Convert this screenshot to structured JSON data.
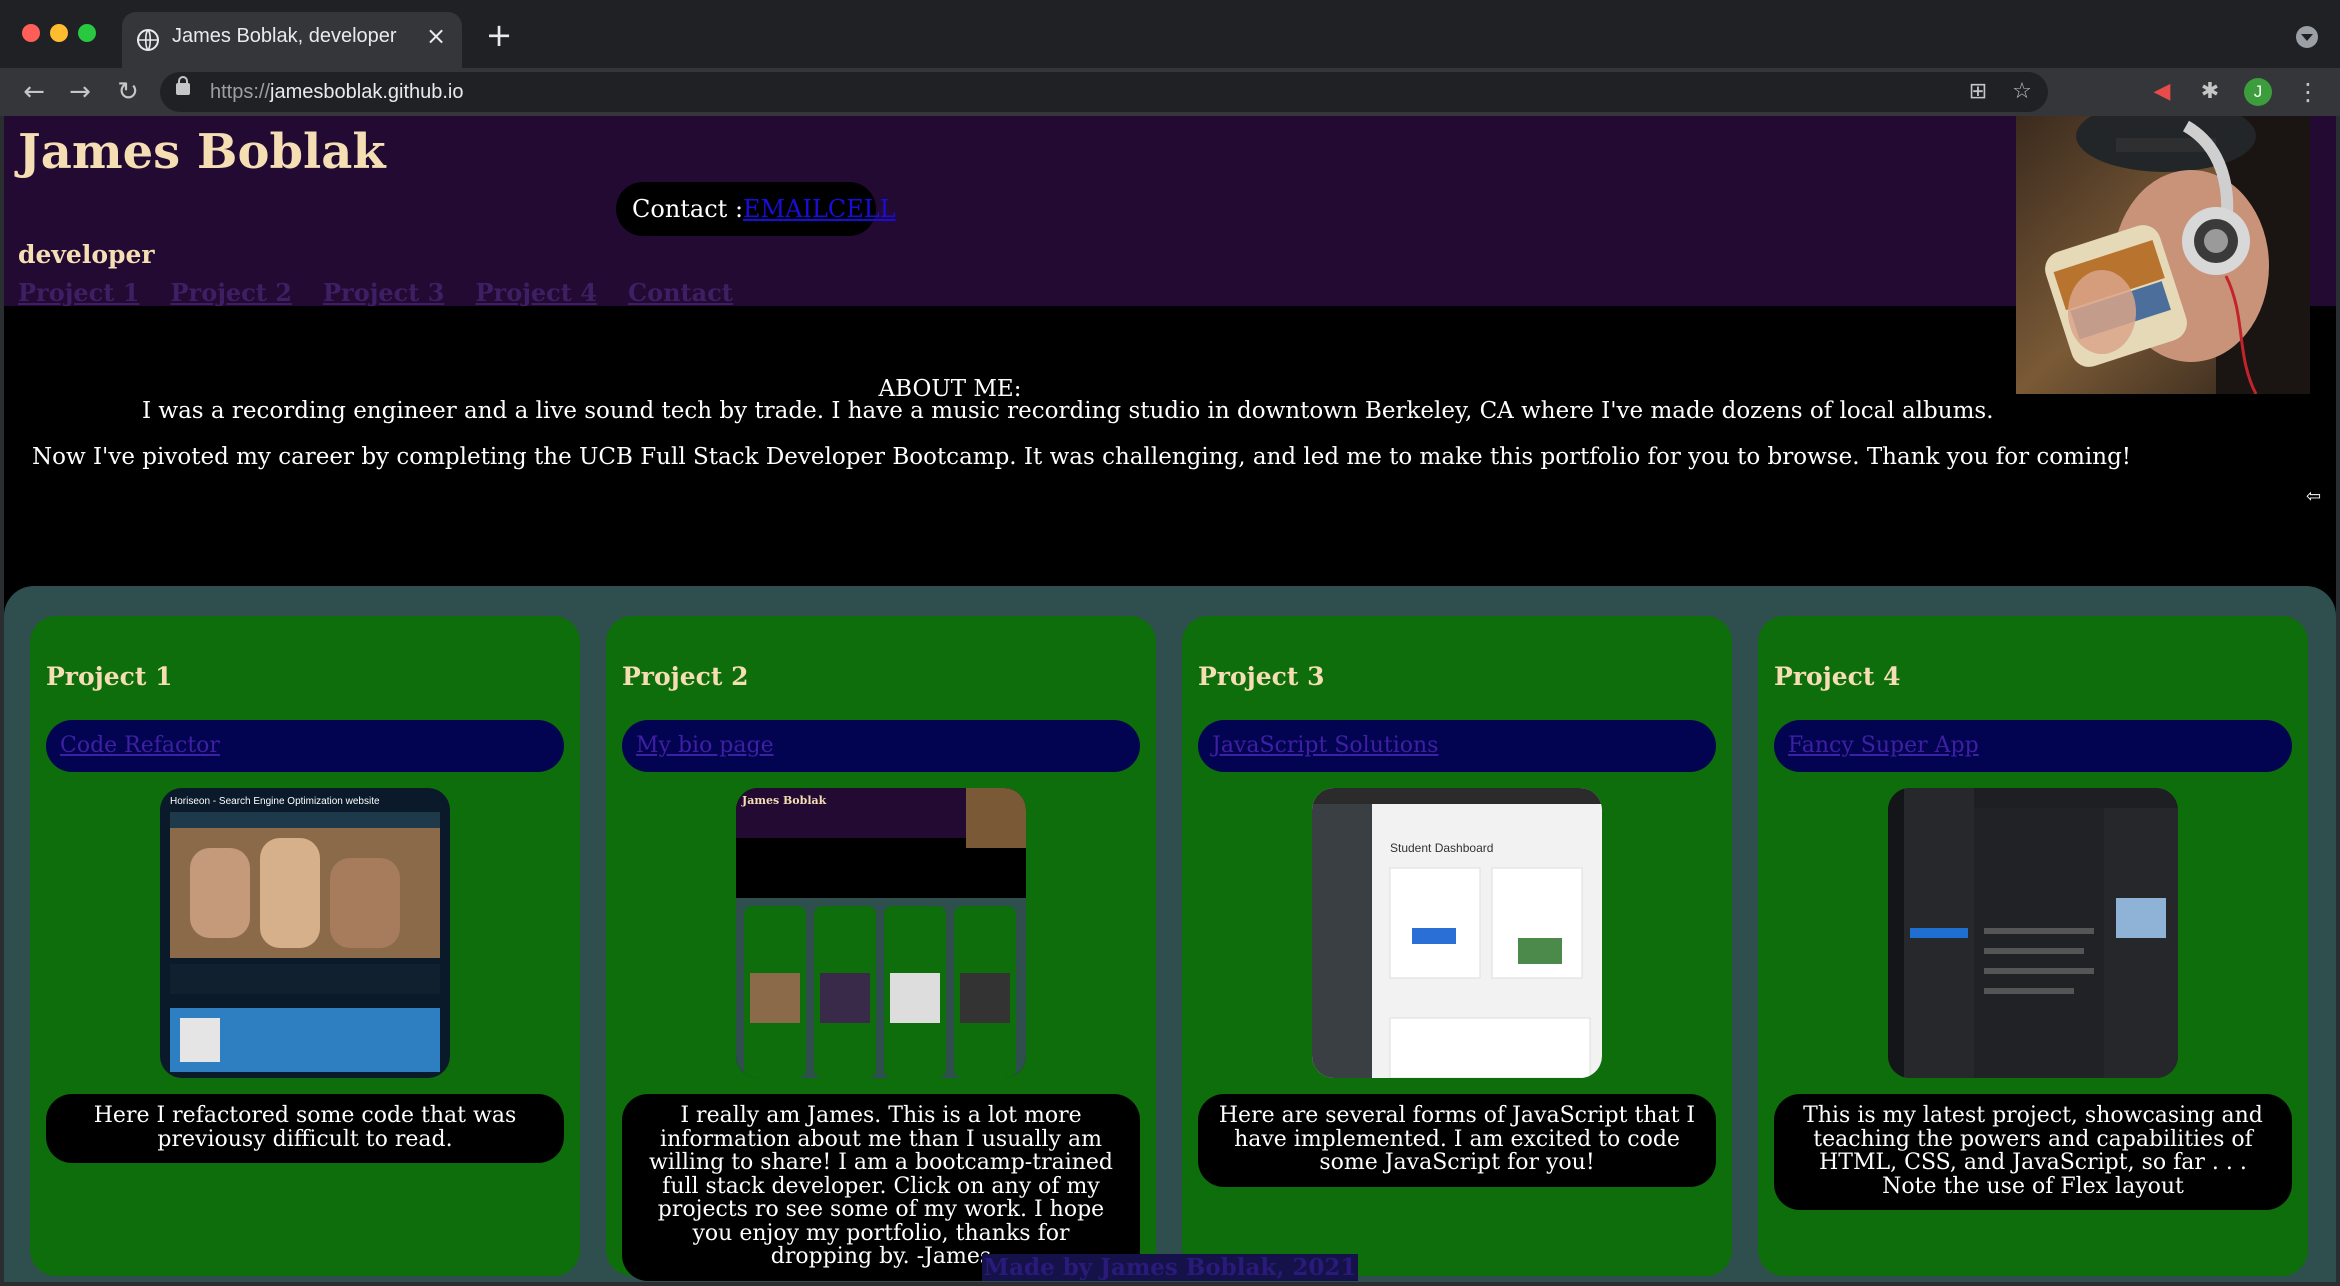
{
  "browser": {
    "tab_title": "James Boblak, developer",
    "url_scheme": "https://",
    "url_host": "jamesboblak.github.io",
    "profile_initial": "J"
  },
  "header": {
    "title": "James Boblak",
    "contact_label": "Contact :",
    "contact_email": "EMAIL",
    "contact_cell": "CELL",
    "tagline": "developer",
    "nav": [
      "Project 1",
      "Project 2",
      "Project 3",
      "Project 4",
      "Contact"
    ]
  },
  "about": {
    "heading": "ABOUT ME:",
    "line1": "I was a recording engineer and a live sound tech by trade. I have a music recording studio in downtown Berkeley, CA where I've made dozens of local albums.",
    "line2": "Now I've pivoted my career by completing the UCB Full Stack Developer Bootcamp. It was challenging, and led me to make this portfolio for you to browse. Thank you for coming!"
  },
  "projects": [
    {
      "title": "Project 1",
      "link": "Code Refactor",
      "thumb_caption": "Horiseon - Search Engine Optimization website",
      "description": "Here I refactored some code that was previousy difficult to read."
    },
    {
      "title": "Project 2",
      "link": "My bio page",
      "thumb_caption": "James Boblak",
      "description": "I really am James. This is a lot more information about me than I usually am willing to share! I am a bootcamp-trained full stack developer. Click on any of my projects ro see some of my work. I hope you enjoy my portfolio, thanks for dropping by. -James"
    },
    {
      "title": "Project 3",
      "link": "JavaScript Solutions",
      "thumb_caption": "Student Dashboard",
      "description": "Here are several forms of JavaScript that I have implemented. I am excited to code some JavaScript for you!"
    },
    {
      "title": "Project 4",
      "link": "Fancy Super App",
      "thumb_caption": "",
      "description": "This is my latest project, showcasing and teaching the powers and capabilities of HTML, CSS, and JavaScript, so far . . . Note the use of Flex layout"
    }
  ],
  "footer": "Made by James Boblak, 2021",
  "colors": {
    "header_bg": "#220a33",
    "accent_text": "#f5deb3",
    "card_bg": "#0e6e0c",
    "link_pill_bg": "#020452",
    "section_bg": "#2f4f4f"
  }
}
